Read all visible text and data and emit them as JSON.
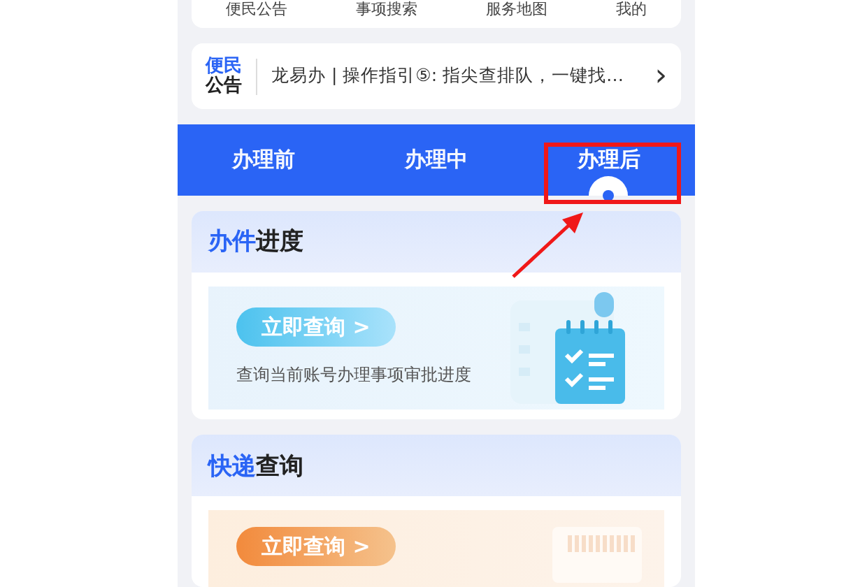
{
  "nav": [
    {
      "label": "便民公告"
    },
    {
      "label": "事项搜索"
    },
    {
      "label": "服务地图"
    },
    {
      "label": "我的"
    }
  ],
  "notice": {
    "badge_top": "便民",
    "badge_bottom": "公告",
    "text": "龙易办 | 操作指引⑤: 指尖查排队，一键找…",
    "chevron": "›"
  },
  "tabs": [
    {
      "label": "办理前",
      "selected": false
    },
    {
      "label": "办理中",
      "selected": false
    },
    {
      "label": "办理后",
      "selected": true
    }
  ],
  "cards": [
    {
      "kind": "progress",
      "title_accent": "办件",
      "title_rest": "进度",
      "button": "立即查询 >",
      "description": "查询当前账号办理事项审批进度"
    },
    {
      "kind": "express",
      "title_accent": "快递",
      "title_rest": "查询",
      "button": "立即查询 >"
    }
  ]
}
